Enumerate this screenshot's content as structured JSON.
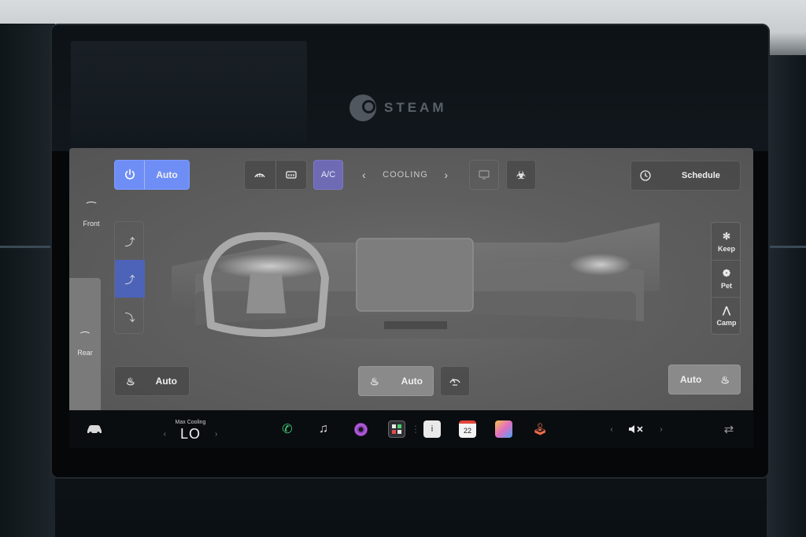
{
  "background": {
    "steam_logo_text": "STEAM"
  },
  "climate": {
    "power": {
      "icon": "power-icon",
      "label": "Auto",
      "state": "on"
    },
    "defrost_front_icon": "front-defrost-icon",
    "defrost_rear_icon": "rear-defrost-icon",
    "ac_label": "A/C",
    "mode": {
      "label": "COOLING",
      "prev_icon": "chevron-left-icon",
      "next_icon": "chevron-right-icon"
    },
    "screen_icon": "screen-recirculate-icon",
    "bioweapon_icon": "biohazard-icon",
    "schedule": {
      "icon": "clock-icon",
      "label": "Schedule"
    },
    "zones": {
      "front_label": "Front",
      "rear_label": "Rear"
    },
    "vents": [
      "vent-face-icon",
      "vent-face-feet-icon",
      "vent-feet-icon"
    ],
    "selected_vent_index": 1,
    "right_modes": [
      {
        "label": "Keep",
        "icon": "fan-icon"
      },
      {
        "label": "Pet",
        "icon": "paw-icon"
      },
      {
        "label": "Camp",
        "icon": "tent-icon"
      }
    ],
    "seat_left": {
      "icon": "seat-heater-icon",
      "label": "Auto"
    },
    "steering_wheel": {
      "icon": "steering-wheel-heat-icon",
      "label": "Auto"
    },
    "wiper_heat_icon": "wiper-heat-icon",
    "seat_right": {
      "icon": "seat-heater-icon",
      "label": "Auto"
    }
  },
  "taskbar": {
    "car_icon": "car-icon",
    "temperature_caption": "Max Cooling",
    "temperature_value": "LO",
    "calendar_day": "22",
    "volume_icon": "mute-icon",
    "swap_icon": "swap-icon"
  },
  "colors": {
    "accent_blue": "#6f8ef5",
    "selected_vent": "#4d63b8",
    "ac_purple": "#6e6ab4",
    "panel_bg": "#5f5f5f",
    "taskbar_bg": "#0a0d10"
  }
}
